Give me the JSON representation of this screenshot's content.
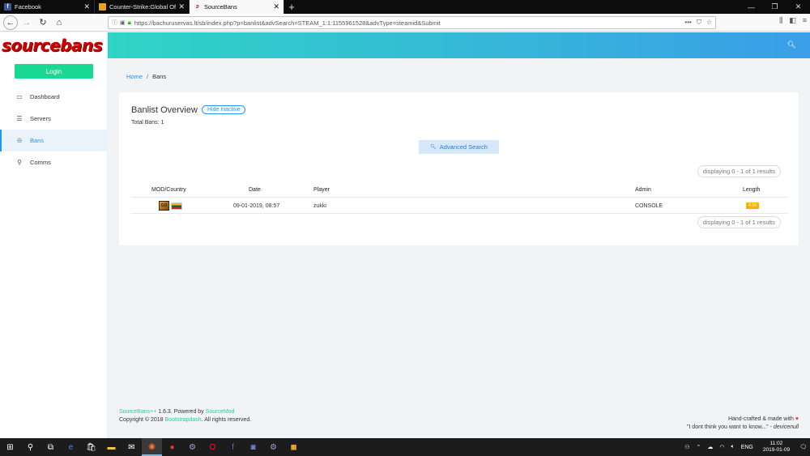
{
  "browser": {
    "tabs": [
      {
        "title": "Facebook",
        "icon": "facebook-icon",
        "icon_color": "#3b5998",
        "active": false
      },
      {
        "title": "Counter-Strike:Global Offensive",
        "icon": "csgo-icon",
        "icon_color": "#e5a12b",
        "active": false
      },
      {
        "title": "SourceBans",
        "icon": "sourcebans-icon",
        "icon_color": "#cc0000",
        "active": true
      }
    ],
    "new_tab": "+",
    "url": "https://bachuruservas.lt/sb/index.php?p=banlist&advSearch=STEAM_1:1:1155961528&advType=steamid&Submit",
    "url_menu": "•••"
  },
  "sidebar": {
    "logo": "sourcebans",
    "login_label": "Login",
    "items": [
      {
        "label": "Dashboard",
        "icon": "monitor-icon",
        "active": false
      },
      {
        "label": "Servers",
        "icon": "server-icon",
        "active": false
      },
      {
        "label": "Bans",
        "icon": "ban-icon",
        "active": true
      },
      {
        "label": "Comms",
        "icon": "mic-icon",
        "active": false
      }
    ]
  },
  "breadcrumb": {
    "home": "Home",
    "separator": "/",
    "current": "Bans"
  },
  "banlist": {
    "title": "Banlist Overview",
    "hide_inactive": "Hide Inactive",
    "total": "Total Bans: 1",
    "advanced_search": "Advanced Search",
    "pager_text": "displaying 0 - 1 of 1 results",
    "columns": {
      "mod": "MOD/Country",
      "date": "Date",
      "player": "Player",
      "admin": "Admin",
      "length": "Length"
    },
    "rows": [
      {
        "date": "09-01-2019, 08:57",
        "player": "zukki",
        "admin": "CONSOLE",
        "length": "4 hr",
        "country": "Lithuania"
      }
    ]
  },
  "footer": {
    "brand": "SourceBans++",
    "version": " 1.6.3. Powered by ",
    "sourcemod": "SourceMod",
    "copyright": "Copyright © 2018 ",
    "bootstrapdash": "Bootstrapdash",
    "rights": ". All rights reserved.",
    "handcrafted": "Hand-crafted & made with",
    "quote": "\"I dont think you want to know...\" - ",
    "quote_author": "devicenull"
  },
  "taskbar": {
    "lang": "ENG",
    "time": "11:02",
    "date": "2019-01-09"
  },
  "colors": {
    "accent": "#2196f3",
    "login": "#19d895",
    "badge": "#ffaf00"
  }
}
